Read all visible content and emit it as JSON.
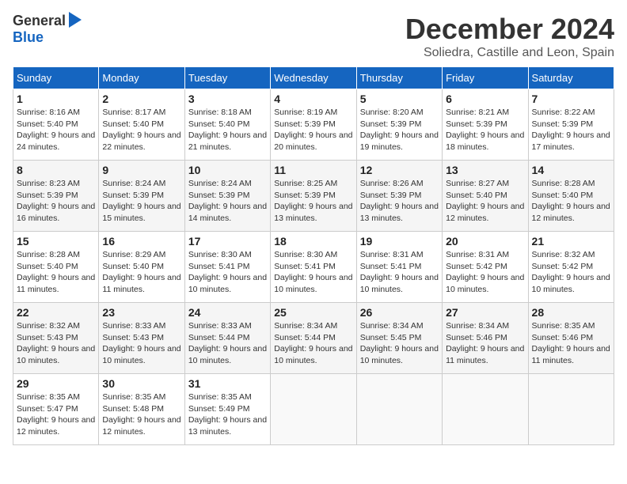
{
  "logo": {
    "general": "General",
    "blue": "Blue"
  },
  "title": "December 2024",
  "location": "Soliedra, Castille and Leon, Spain",
  "days_of_week": [
    "Sunday",
    "Monday",
    "Tuesday",
    "Wednesday",
    "Thursday",
    "Friday",
    "Saturday"
  ],
  "weeks": [
    [
      {
        "day": "1",
        "sunrise": "Sunrise: 8:16 AM",
        "sunset": "Sunset: 5:40 PM",
        "daylight": "Daylight: 9 hours and 24 minutes."
      },
      {
        "day": "2",
        "sunrise": "Sunrise: 8:17 AM",
        "sunset": "Sunset: 5:40 PM",
        "daylight": "Daylight: 9 hours and 22 minutes."
      },
      {
        "day": "3",
        "sunrise": "Sunrise: 8:18 AM",
        "sunset": "Sunset: 5:40 PM",
        "daylight": "Daylight: 9 hours and 21 minutes."
      },
      {
        "day": "4",
        "sunrise": "Sunrise: 8:19 AM",
        "sunset": "Sunset: 5:39 PM",
        "daylight": "Daylight: 9 hours and 20 minutes."
      },
      {
        "day": "5",
        "sunrise": "Sunrise: 8:20 AM",
        "sunset": "Sunset: 5:39 PM",
        "daylight": "Daylight: 9 hours and 19 minutes."
      },
      {
        "day": "6",
        "sunrise": "Sunrise: 8:21 AM",
        "sunset": "Sunset: 5:39 PM",
        "daylight": "Daylight: 9 hours and 18 minutes."
      },
      {
        "day": "7",
        "sunrise": "Sunrise: 8:22 AM",
        "sunset": "Sunset: 5:39 PM",
        "daylight": "Daylight: 9 hours and 17 minutes."
      }
    ],
    [
      {
        "day": "8",
        "sunrise": "Sunrise: 8:23 AM",
        "sunset": "Sunset: 5:39 PM",
        "daylight": "Daylight: 9 hours and 16 minutes."
      },
      {
        "day": "9",
        "sunrise": "Sunrise: 8:24 AM",
        "sunset": "Sunset: 5:39 PM",
        "daylight": "Daylight: 9 hours and 15 minutes."
      },
      {
        "day": "10",
        "sunrise": "Sunrise: 8:24 AM",
        "sunset": "Sunset: 5:39 PM",
        "daylight": "Daylight: 9 hours and 14 minutes."
      },
      {
        "day": "11",
        "sunrise": "Sunrise: 8:25 AM",
        "sunset": "Sunset: 5:39 PM",
        "daylight": "Daylight: 9 hours and 13 minutes."
      },
      {
        "day": "12",
        "sunrise": "Sunrise: 8:26 AM",
        "sunset": "Sunset: 5:39 PM",
        "daylight": "Daylight: 9 hours and 13 minutes."
      },
      {
        "day": "13",
        "sunrise": "Sunrise: 8:27 AM",
        "sunset": "Sunset: 5:40 PM",
        "daylight": "Daylight: 9 hours and 12 minutes."
      },
      {
        "day": "14",
        "sunrise": "Sunrise: 8:28 AM",
        "sunset": "Sunset: 5:40 PM",
        "daylight": "Daylight: 9 hours and 12 minutes."
      }
    ],
    [
      {
        "day": "15",
        "sunrise": "Sunrise: 8:28 AM",
        "sunset": "Sunset: 5:40 PM",
        "daylight": "Daylight: 9 hours and 11 minutes."
      },
      {
        "day": "16",
        "sunrise": "Sunrise: 8:29 AM",
        "sunset": "Sunset: 5:40 PM",
        "daylight": "Daylight: 9 hours and 11 minutes."
      },
      {
        "day": "17",
        "sunrise": "Sunrise: 8:30 AM",
        "sunset": "Sunset: 5:41 PM",
        "daylight": "Daylight: 9 hours and 10 minutes."
      },
      {
        "day": "18",
        "sunrise": "Sunrise: 8:30 AM",
        "sunset": "Sunset: 5:41 PM",
        "daylight": "Daylight: 9 hours and 10 minutes."
      },
      {
        "day": "19",
        "sunrise": "Sunrise: 8:31 AM",
        "sunset": "Sunset: 5:41 PM",
        "daylight": "Daylight: 9 hours and 10 minutes."
      },
      {
        "day": "20",
        "sunrise": "Sunrise: 8:31 AM",
        "sunset": "Sunset: 5:42 PM",
        "daylight": "Daylight: 9 hours and 10 minutes."
      },
      {
        "day": "21",
        "sunrise": "Sunrise: 8:32 AM",
        "sunset": "Sunset: 5:42 PM",
        "daylight": "Daylight: 9 hours and 10 minutes."
      }
    ],
    [
      {
        "day": "22",
        "sunrise": "Sunrise: 8:32 AM",
        "sunset": "Sunset: 5:43 PM",
        "daylight": "Daylight: 9 hours and 10 minutes."
      },
      {
        "day": "23",
        "sunrise": "Sunrise: 8:33 AM",
        "sunset": "Sunset: 5:43 PM",
        "daylight": "Daylight: 9 hours and 10 minutes."
      },
      {
        "day": "24",
        "sunrise": "Sunrise: 8:33 AM",
        "sunset": "Sunset: 5:44 PM",
        "daylight": "Daylight: 9 hours and 10 minutes."
      },
      {
        "day": "25",
        "sunrise": "Sunrise: 8:34 AM",
        "sunset": "Sunset: 5:44 PM",
        "daylight": "Daylight: 9 hours and 10 minutes."
      },
      {
        "day": "26",
        "sunrise": "Sunrise: 8:34 AM",
        "sunset": "Sunset: 5:45 PM",
        "daylight": "Daylight: 9 hours and 10 minutes."
      },
      {
        "day": "27",
        "sunrise": "Sunrise: 8:34 AM",
        "sunset": "Sunset: 5:46 PM",
        "daylight": "Daylight: 9 hours and 11 minutes."
      },
      {
        "day": "28",
        "sunrise": "Sunrise: 8:35 AM",
        "sunset": "Sunset: 5:46 PM",
        "daylight": "Daylight: 9 hours and 11 minutes."
      }
    ],
    [
      {
        "day": "29",
        "sunrise": "Sunrise: 8:35 AM",
        "sunset": "Sunset: 5:47 PM",
        "daylight": "Daylight: 9 hours and 12 minutes."
      },
      {
        "day": "30",
        "sunrise": "Sunrise: 8:35 AM",
        "sunset": "Sunset: 5:48 PM",
        "daylight": "Daylight: 9 hours and 12 minutes."
      },
      {
        "day": "31",
        "sunrise": "Sunrise: 8:35 AM",
        "sunset": "Sunset: 5:49 PM",
        "daylight": "Daylight: 9 hours and 13 minutes."
      },
      null,
      null,
      null,
      null
    ]
  ]
}
